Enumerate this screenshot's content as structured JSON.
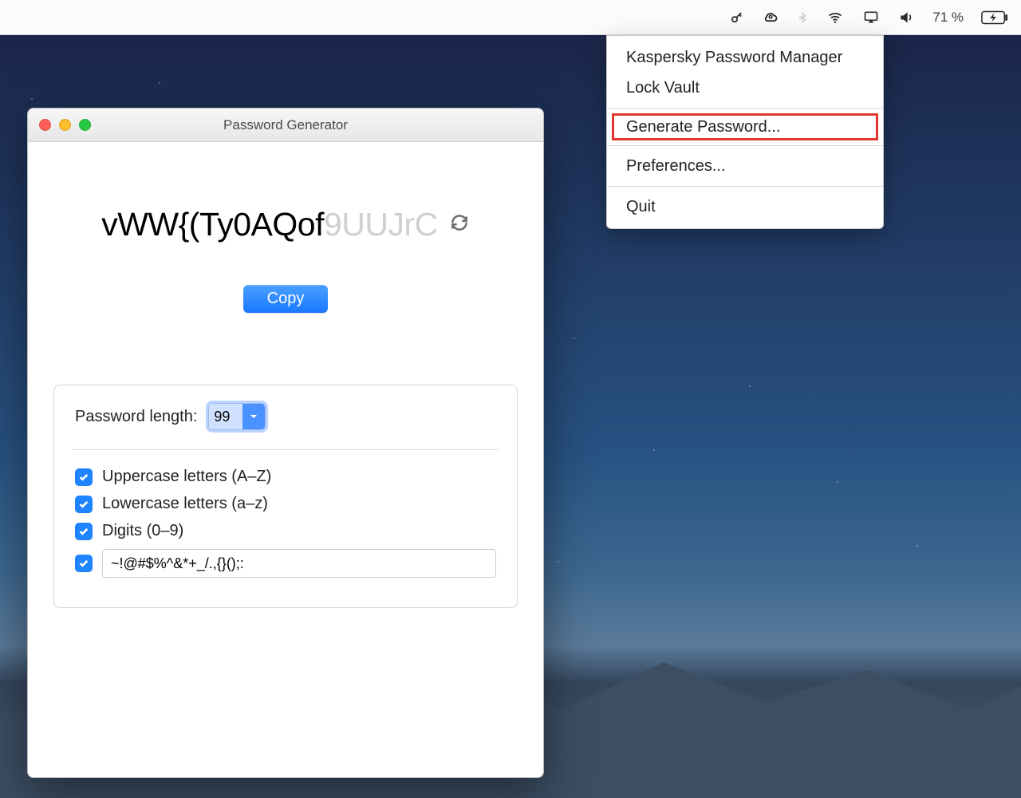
{
  "menubar": {
    "battery_pct": "71 %"
  },
  "tray_menu": {
    "items": [
      "Kaspersky Password Manager",
      "Lock Vault",
      "Generate Password...",
      "Preferences...",
      "Quit"
    ]
  },
  "window": {
    "title": "Password Generator"
  },
  "password": {
    "strong_part": "vWW{(Ty0AQof",
    "faded_part": "9UUJrC"
  },
  "actions": {
    "copy_label": "Copy"
  },
  "options": {
    "length_label": "Password length:",
    "length_value": "99",
    "uppercase_label": "Uppercase letters (A–Z)",
    "lowercase_label": "Lowercase letters (a–z)",
    "digits_label": "Digits (0–9)",
    "symbols_value": "~!@#$%^&*+_/.,{}();:"
  }
}
